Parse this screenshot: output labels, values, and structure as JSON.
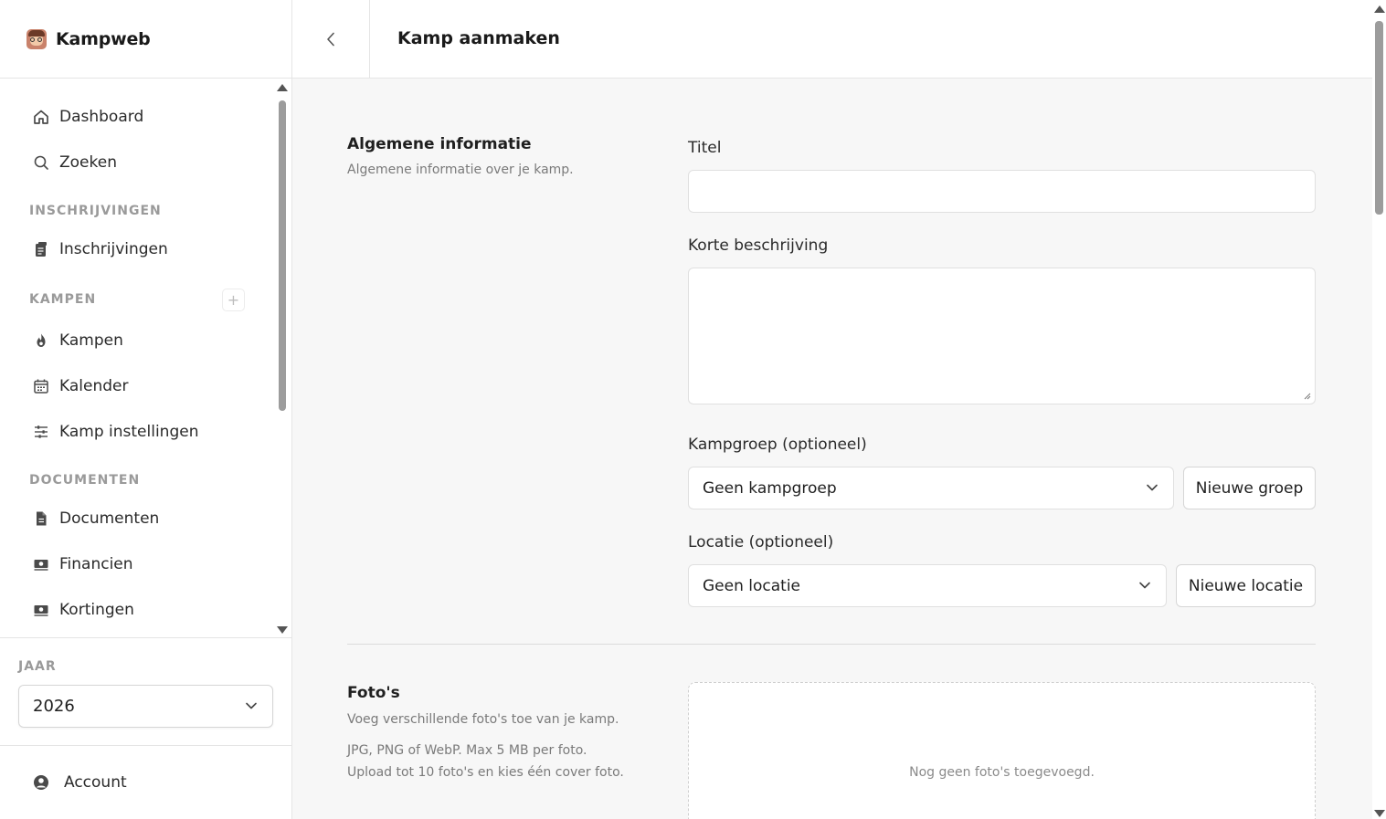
{
  "app": {
    "name": "Kampweb"
  },
  "header": {
    "title": "Kamp aanmaken"
  },
  "sidebar": {
    "items": [
      {
        "label": "Dashboard",
        "icon": "home-icon"
      },
      {
        "label": "Zoeken",
        "icon": "search-icon"
      }
    ],
    "sections": [
      {
        "label": "INSCHRIJVINGEN",
        "items": [
          {
            "label": "Inschrijvingen",
            "icon": "clipboard-icon"
          }
        ]
      },
      {
        "label": "KAMPEN",
        "items": [
          {
            "label": "Kampen",
            "icon": "fire-icon"
          },
          {
            "label": "Kalender",
            "icon": "calendar-icon"
          },
          {
            "label": "Kamp instellingen",
            "icon": "sliders-icon"
          }
        ]
      },
      {
        "label": "DOCUMENTEN",
        "items": [
          {
            "label": "Documenten",
            "icon": "document-icon"
          },
          {
            "label": "Financien",
            "icon": "money-icon"
          },
          {
            "label": "Kortingen",
            "icon": "money-icon"
          }
        ]
      }
    ],
    "year": {
      "label": "JAAR",
      "value": "2026"
    },
    "account": {
      "label": "Account"
    }
  },
  "form": {
    "general": {
      "title": "Algemene informatie",
      "description": "Algemene informatie over je kamp.",
      "title_label": "Titel",
      "title_value": "",
      "short_desc_label": "Korte beschrijving",
      "short_desc_value": "",
      "group_label": "Kampgroep (optioneel)",
      "group_value": "Geen kampgroep",
      "new_group_button": "Nieuwe groep",
      "location_label": "Locatie (optioneel)",
      "location_value": "Geen locatie",
      "new_location_button": "Nieuwe locatie"
    },
    "photos": {
      "title": "Foto's",
      "description": "Voeg verschillende foto's toe van je kamp.",
      "hint_line1": "JPG, PNG of WebP. Max 5 MB per foto.",
      "hint_line2": "Upload tot 10 foto's en kies één cover foto.",
      "empty_text": "Nog geen foto's toegevoegd."
    }
  },
  "colors": {
    "border": "#e5e5e5",
    "background": "#f7f7f7",
    "text": "#1f1f1f",
    "muted": "#9a9a9a"
  }
}
